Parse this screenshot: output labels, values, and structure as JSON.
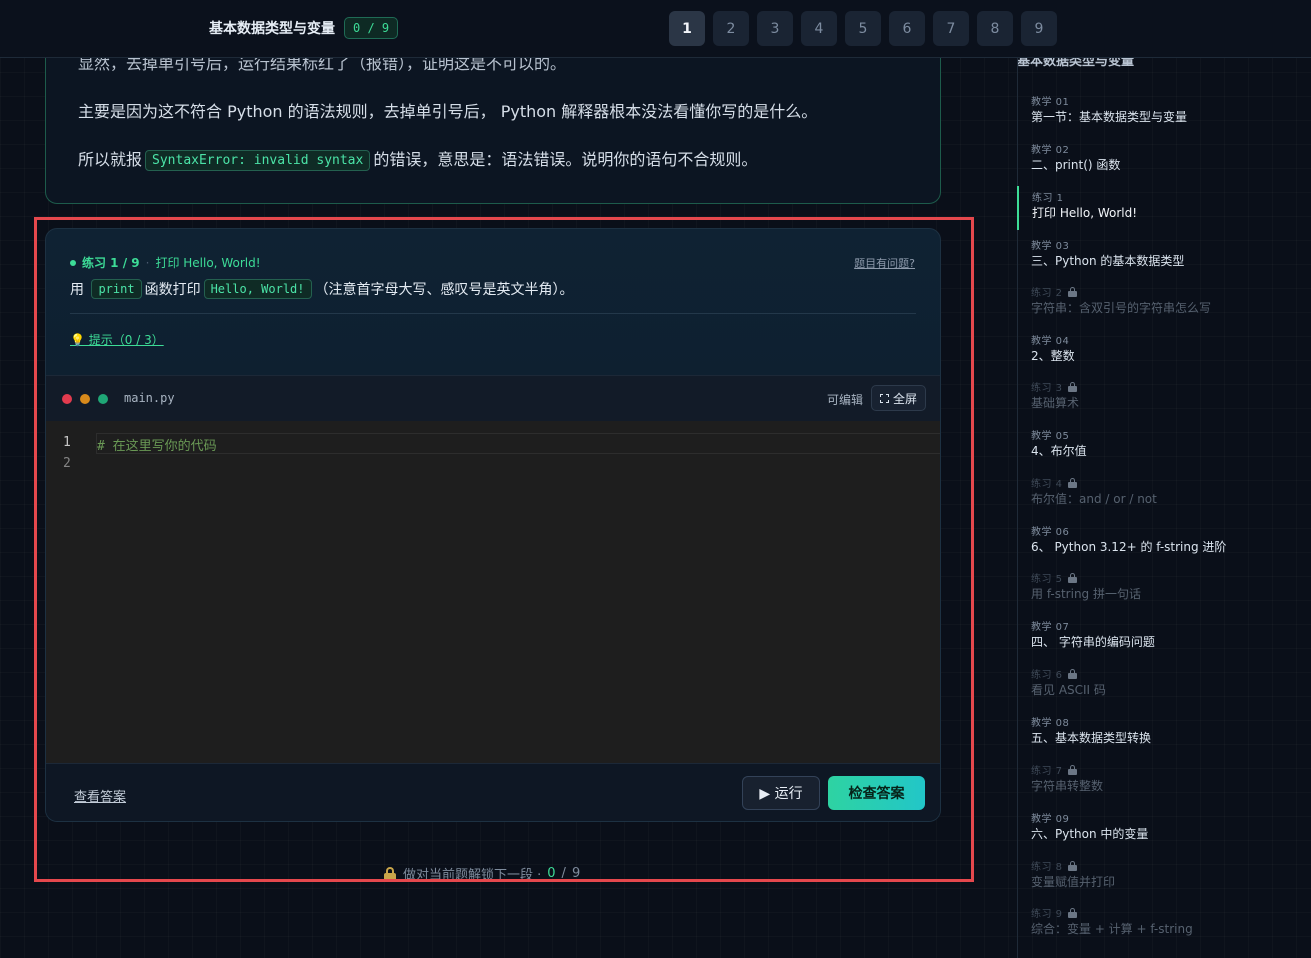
{
  "topbar": {
    "title": "基本数据类型与变量",
    "progress": "0 / 9",
    "pages": [
      "1",
      "2",
      "3",
      "4",
      "5",
      "6",
      "7",
      "8",
      "9"
    ],
    "active_page": "1"
  },
  "prev_lesson": {
    "line_cut": "显然，去掉单引号后，运行结果标红了（报错），证明这是不可以的。",
    "line2": "主要是因为这不符合 Python 的语法规则，去掉单引号后， Python 解释器根本没法看懂你写的是什么。",
    "line3_before": "所以就报",
    "line3_code": "SyntaxError: invalid syntax",
    "line3_after": "的错误，意思是：语法错误。说明你的语句不合规则。"
  },
  "exercise": {
    "label": "练习 1 / 9",
    "separator": "·",
    "subtitle": "打印 Hello, World!",
    "report": "题目有问题?",
    "desc_prefix": "用",
    "desc_code1": "print",
    "desc_mid": "函数打印",
    "desc_code2": "Hello, World!",
    "desc_suffix": "（注意首字母大写、感叹号是英文半角）。",
    "hint": "💡 提示（0 / 3）"
  },
  "editor": {
    "filename": "main.py",
    "editable_label": "可编辑",
    "fullscreen_label": "全屏",
    "line_numbers": [
      "1",
      "2"
    ],
    "code_comment": "# 在这里写你的代码",
    "view_answer": "查看答案",
    "run_label": "▶ 运行",
    "check_label": "检查答案"
  },
  "unlock_status": {
    "text": "做对当前题解锁下一段 ·",
    "done": "0",
    "slash": "/",
    "total": "9"
  },
  "sidebar": {
    "title_cut": "基本数据类型与变量",
    "items": [
      {
        "kind": "教学 01",
        "title": "第一节：基本数据类型与变量",
        "locked": false,
        "active": false
      },
      {
        "kind": "教学 02",
        "title": "二、print() 函数",
        "locked": false,
        "active": false
      },
      {
        "kind": "练习 1",
        "title": "打印 Hello, World!",
        "locked": false,
        "active": true
      },
      {
        "kind": "教学 03",
        "title": "三、Python 的基本数据类型",
        "locked": false,
        "active": false
      },
      {
        "kind": "练习 2",
        "title": "字符串：含双引号的字符串怎么写",
        "locked": true,
        "active": false
      },
      {
        "kind": "教学 04",
        "title": "2、整数",
        "locked": false,
        "active": false
      },
      {
        "kind": "练习 3",
        "title": "基础算术",
        "locked": true,
        "active": false
      },
      {
        "kind": "教学 05",
        "title": "4、布尔值",
        "locked": false,
        "active": false
      },
      {
        "kind": "练习 4",
        "title": "布尔值：and / or / not",
        "locked": true,
        "active": false
      },
      {
        "kind": "教学 06",
        "title": "6、 Python 3.12+ 的 f-string 进阶",
        "locked": false,
        "active": false
      },
      {
        "kind": "练习 5",
        "title": "用 f-string 拼一句话",
        "locked": true,
        "active": false
      },
      {
        "kind": "教学 07",
        "title": "四、 字符串的编码问题",
        "locked": false,
        "active": false
      },
      {
        "kind": "练习 6",
        "title": "看见 ASCII 码",
        "locked": true,
        "active": false
      },
      {
        "kind": "教学 08",
        "title": "五、基本数据类型转换",
        "locked": false,
        "active": false
      },
      {
        "kind": "练习 7",
        "title": "字符串转整数",
        "locked": true,
        "active": false
      },
      {
        "kind": "教学 09",
        "title": "六、Python 中的变量",
        "locked": false,
        "active": false
      },
      {
        "kind": "练习 8",
        "title": "变量赋值并打印",
        "locked": true,
        "active": false
      },
      {
        "kind": "练习 9",
        "title": "综合：变量 + 计算 + f-string",
        "locked": true,
        "active": false
      }
    ]
  },
  "colors": {
    "accent": "#3ddc97",
    "highlight_box": "#e5484d",
    "background": "#0a0f19"
  }
}
